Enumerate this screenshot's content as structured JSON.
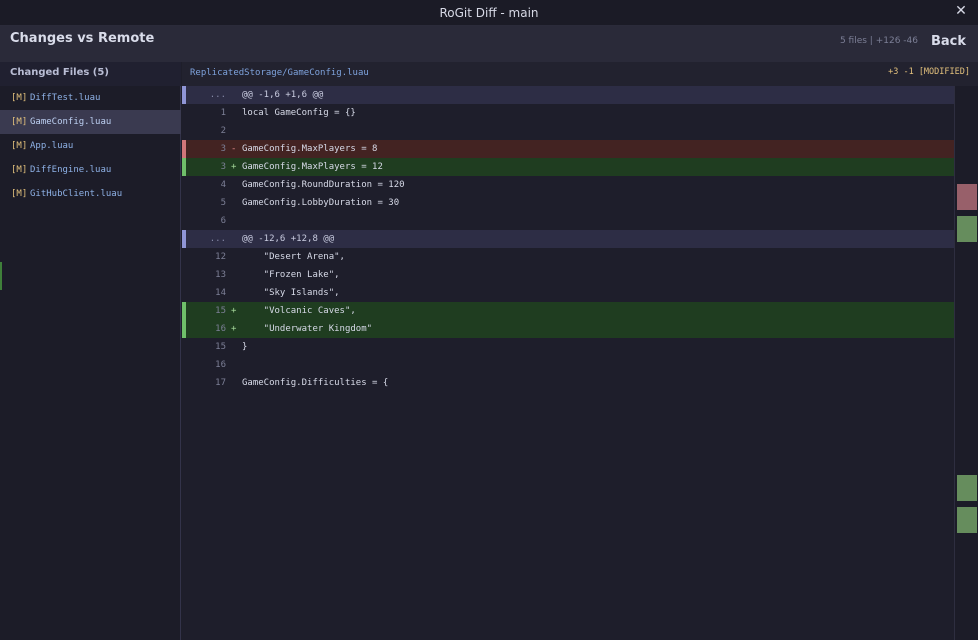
{
  "window": {
    "title": "RoGit Diff - main",
    "close_icon": "close-icon"
  },
  "header": {
    "title": "Changes vs Remote",
    "stats": "5 files | +126 -46",
    "back_label": "Back"
  },
  "sidebar": {
    "heading": "Changed Files (5)",
    "files": [
      {
        "tag": "[M]",
        "name": "DiffTest.luau"
      },
      {
        "tag": "[M]",
        "name": "GameConfig.luau"
      },
      {
        "tag": "[M]",
        "name": "App.luau"
      },
      {
        "tag": "[M]",
        "name": "DiffEngine.luau"
      },
      {
        "tag": "[M]",
        "name": "GitHubClient.luau"
      }
    ],
    "selected_index": 1
  },
  "main": {
    "path": "ReplicatedStorage/GameConfig.luau",
    "summary": "+3 -1 [MODIFIED]",
    "lines": [
      {
        "type": "hunk",
        "num": "...",
        "sign": "",
        "code": "@@ -1,6 +1,6 @@"
      },
      {
        "type": "ctx",
        "num": "1",
        "sign": "",
        "code": "local GameConfig = {}"
      },
      {
        "type": "ctx",
        "num": "2",
        "sign": "",
        "code": ""
      },
      {
        "type": "del",
        "num": "3",
        "sign": "-",
        "code": "GameConfig.MaxPlayers = 8"
      },
      {
        "type": "add",
        "num": "3",
        "sign": "+",
        "code": "GameConfig.MaxPlayers = 12"
      },
      {
        "type": "ctx",
        "num": "4",
        "sign": "",
        "code": "GameConfig.RoundDuration = 120"
      },
      {
        "type": "ctx",
        "num": "5",
        "sign": "",
        "code": "GameConfig.LobbyDuration = 30"
      },
      {
        "type": "ctx",
        "num": "6",
        "sign": "",
        "code": ""
      },
      {
        "type": "hunk",
        "num": "...",
        "sign": "",
        "code": "@@ -12,6 +12,8 @@"
      },
      {
        "type": "ctx",
        "num": "12",
        "sign": "",
        "code": "    \"Desert Arena\","
      },
      {
        "type": "ctx",
        "num": "13",
        "sign": "",
        "code": "    \"Frozen Lake\","
      },
      {
        "type": "ctx",
        "num": "14",
        "sign": "",
        "code": "    \"Sky Islands\","
      },
      {
        "type": "add",
        "num": "15",
        "sign": "+",
        "code": "    \"Volcanic Caves\","
      },
      {
        "type": "add",
        "num": "16",
        "sign": "+",
        "code": "    \"Underwater Kingdom\""
      },
      {
        "type": "ctx",
        "num": "15",
        "sign": "",
        "code": "}"
      },
      {
        "type": "ctx",
        "num": "16",
        "sign": "",
        "code": ""
      },
      {
        "type": "ctx",
        "num": "17",
        "sign": "",
        "code": "GameConfig.Difficulties = {"
      }
    ]
  },
  "minimap": {
    "marks": [
      {
        "kind": "del"
      },
      {
        "kind": "add"
      },
      {
        "kind": "add"
      },
      {
        "kind": "add"
      }
    ]
  },
  "colors": {
    "deleted": "#432322",
    "added": "#1f3d20",
    "hunk": "#2d2d45",
    "accent_yellow": "#e2c07c",
    "path_blue": "#7ea2dc"
  }
}
